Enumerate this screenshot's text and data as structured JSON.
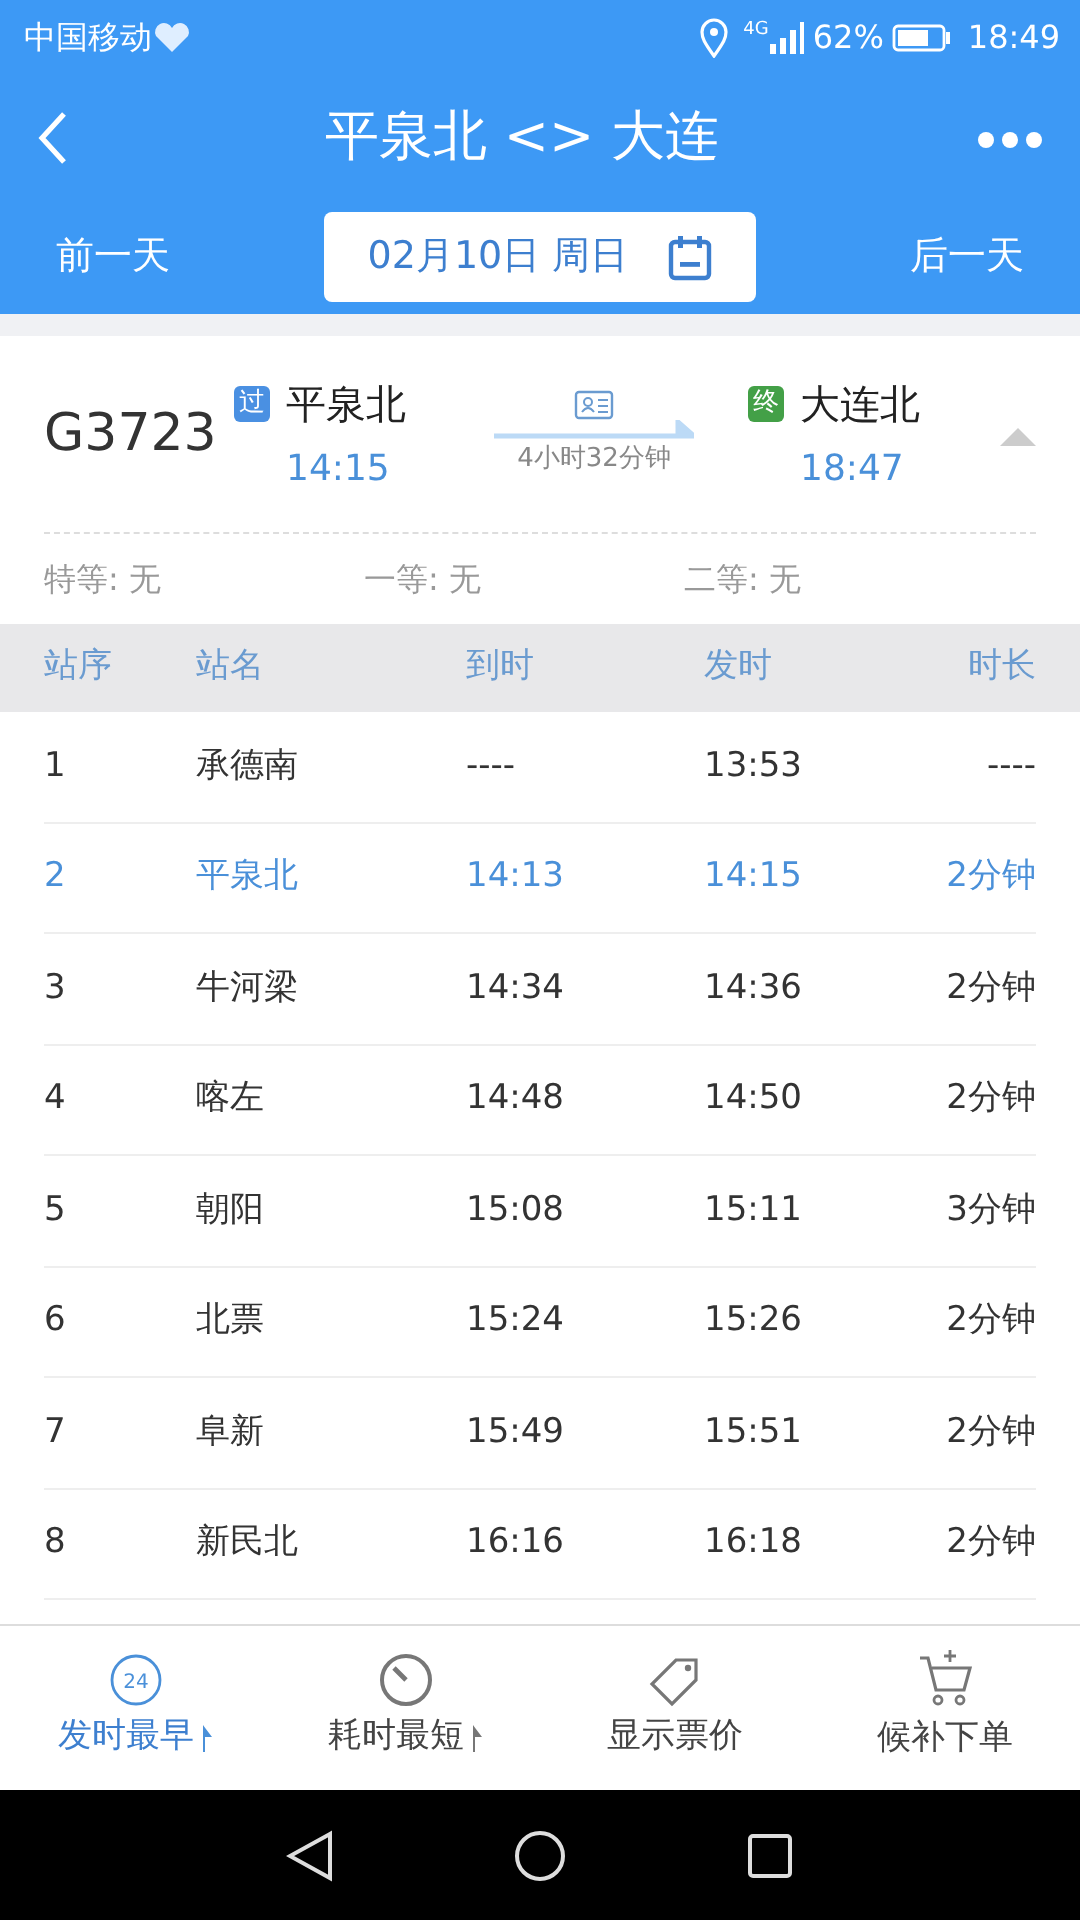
{
  "status_bar": {
    "carrier": "中国移动",
    "network": "4G",
    "battery": "62%",
    "time": "18:49"
  },
  "header": {
    "title": "平泉北 <> 大连"
  },
  "date_nav": {
    "prev": "前一天",
    "date": "02月10日 周日",
    "next": "后一天"
  },
  "train": {
    "number": "G3723",
    "expanded": true,
    "duration": "4小时32分钟",
    "from": {
      "badge": "过",
      "color": "#4a90e2",
      "name": "平泉北",
      "time": "14:15"
    },
    "to": {
      "badge": "终",
      "color": "#43a047",
      "name": "大连北",
      "time": "18:47"
    }
  },
  "seats": [
    "特等: 无",
    "一等: 无",
    "二等: 无"
  ],
  "table": {
    "columns": [
      "站序",
      "站名",
      "到时",
      "发时",
      "时长"
    ],
    "rows": [
      {
        "cells": [
          "1",
          "承德南",
          "----",
          "13:53",
          "----"
        ],
        "highlighted": false
      },
      {
        "cells": [
          "2",
          "平泉北",
          "14:13",
          "14:15",
          "2分钟"
        ],
        "highlighted": true
      },
      {
        "cells": [
          "3",
          "牛河梁",
          "14:34",
          "14:36",
          "2分钟"
        ],
        "highlighted": false
      },
      {
        "cells": [
          "4",
          "喀左",
          "14:48",
          "14:50",
          "2分钟"
        ],
        "highlighted": false
      },
      {
        "cells": [
          "5",
          "朝阳",
          "15:08",
          "15:11",
          "3分钟"
        ],
        "highlighted": false
      },
      {
        "cells": [
          "6",
          "北票",
          "15:24",
          "15:26",
          "2分钟"
        ],
        "highlighted": false
      },
      {
        "cells": [
          "7",
          "阜新",
          "15:49",
          "15:51",
          "2分钟"
        ],
        "highlighted": false
      },
      {
        "cells": [
          "8",
          "新民北",
          "16:16",
          "16:18",
          "2分钟"
        ],
        "highlighted": false
      }
    ]
  },
  "bottom_tabs": [
    {
      "kind": "clock24",
      "icon_text": "24",
      "label": "发时最早",
      "selected": true,
      "sort": true
    },
    {
      "kind": "timer",
      "label": "耗时最短",
      "selected": false,
      "sort": true
    },
    {
      "kind": "tag",
      "label": "显示票价",
      "selected": false,
      "sort": false
    },
    {
      "kind": "cart",
      "label": "候补下单",
      "selected": false,
      "sort": false
    }
  ]
}
